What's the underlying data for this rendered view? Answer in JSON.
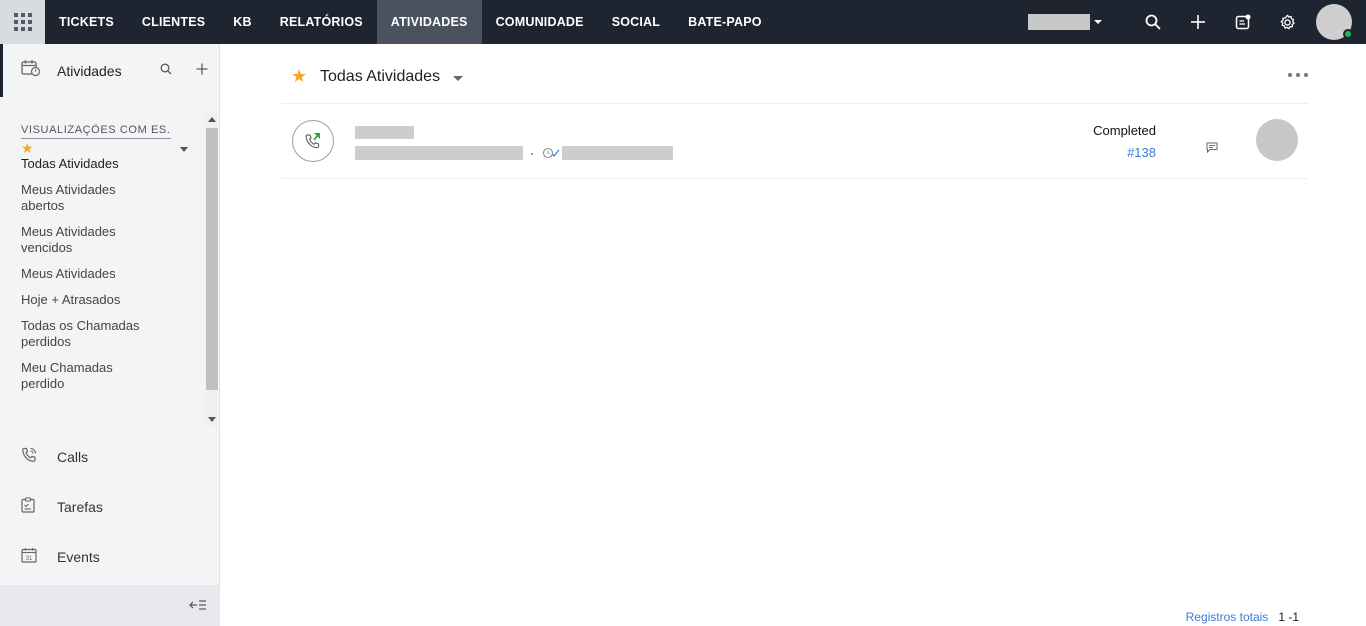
{
  "topnav": {
    "items": [
      {
        "label": "TICKETS"
      },
      {
        "label": "CLIENTES"
      },
      {
        "label": "KB"
      },
      {
        "label": "RELATÓRIOS"
      },
      {
        "label": "ATIVIDADES",
        "active": true
      },
      {
        "label": "COMUNIDADE"
      },
      {
        "label": "SOCIAL"
      },
      {
        "label": "BATE-PAPO"
      }
    ],
    "icons": [
      "apps-grid-icon",
      "search-icon",
      "plus-icon",
      "compose-icon",
      "gear-icon"
    ],
    "presence_color": "#1db954"
  },
  "sidebar": {
    "title": "Atividades",
    "views_title": "VISUALIZAÇÕES COM ES...",
    "views": [
      {
        "label": "Todas Atividades",
        "starred": true
      },
      {
        "label": "Meus Atividades abertos"
      },
      {
        "label": "Meus Atividades vencidos"
      },
      {
        "label": "Meus Atividades"
      },
      {
        "label": "Hoje + Atrasados"
      },
      {
        "label": "Todas os Chamadas perdidos"
      },
      {
        "label": "Meu Chamadas perdido"
      }
    ],
    "modules": [
      {
        "label": "Calls",
        "icon": "phone-icon"
      },
      {
        "label": "Tarefas",
        "icon": "clipboard-icon"
      },
      {
        "label": "Events",
        "icon": "calendar-icon"
      }
    ]
  },
  "main": {
    "view_title": "Todas Atividades",
    "rows": [
      {
        "status": "Completed",
        "ticket": "#138",
        "icon": "incoming-call-icon"
      }
    ],
    "footer": {
      "label": "Registros totais",
      "count": "1 -1"
    }
  },
  "colors": {
    "accent": "#f5a623",
    "link": "#3a7bd5",
    "nav_bg": "#1e2430"
  }
}
